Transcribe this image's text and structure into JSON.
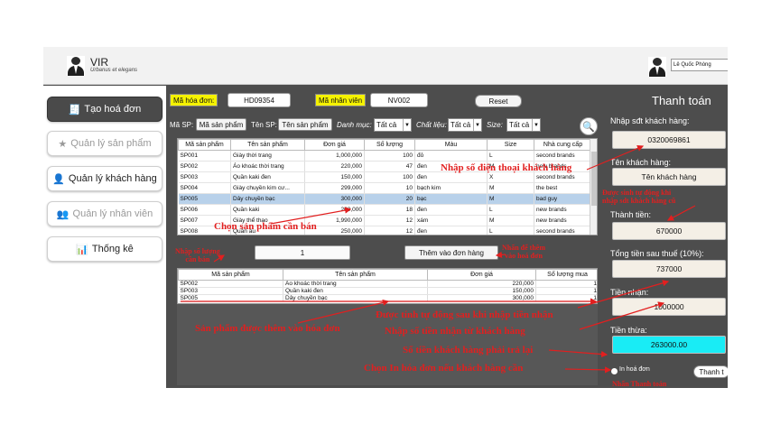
{
  "header": {
    "brand_name": "VIR",
    "brand_slogan": "Urbanus et elegans",
    "user_name": "Lê Quốc Phòng"
  },
  "sidebar": {
    "items": [
      {
        "label": "Tạo hoá đơn",
        "icon": "invoice-icon"
      },
      {
        "label": "Quản lý sản phẩm",
        "icon": "star-icon"
      },
      {
        "label": "Quản lý khách hàng",
        "icon": "customer-icon"
      },
      {
        "label": "Quản lý nhân viên",
        "icon": "staff-icon"
      },
      {
        "label": "Thống kê",
        "icon": "report-icon"
      }
    ]
  },
  "invoice": {
    "invoice_id_label": "Mã hóa đơn:",
    "invoice_id": "HD09354",
    "staff_id_label": "Mã nhân viên",
    "staff_id": "NV002",
    "reset_label": "Reset"
  },
  "filters": {
    "product_id_label": "Mã SP:",
    "product_id_button": "Mã sản phẩm",
    "product_name_label": "Tên SP:",
    "product_name_button": "Tên sản phẩm",
    "category_label": "Danh mục:",
    "category_value": "Tất cả",
    "material_label": "Chất liệu:",
    "material_value": "Tất cả",
    "size_label": "Size:",
    "size_value": "Tất cả"
  },
  "products": {
    "columns": [
      "Mã sản phẩm",
      "Tên sản phẩm",
      "Đơn giá",
      "Số lượng",
      "Màu",
      "Size",
      "Nhà cung cấp"
    ],
    "rows": [
      [
        "SP001",
        "Giày thời trang",
        "1,000,000",
        "100",
        "đỏ",
        "L",
        "second brands"
      ],
      [
        "SP002",
        "Áo khoác thời trang",
        "220,000",
        "47",
        "đen",
        "M",
        "new brands"
      ],
      [
        "SP003",
        "Quần kaki đen",
        "150,000",
        "100",
        "đen",
        "X",
        "second brands"
      ],
      [
        "SP004",
        "Giày chuyền kim cư...",
        "299,000",
        "10",
        "bạch kim",
        "M",
        "the best"
      ],
      [
        "SP005",
        "Dây chuyền bạc",
        "300,000",
        "20",
        "bạc",
        "M",
        "bad guy"
      ],
      [
        "SP006",
        "Quần kaki",
        "200,000",
        "18",
        "đen",
        "L",
        "new brands"
      ],
      [
        "SP007",
        "Giày thể thao",
        "1,990,000",
        "12",
        "xám",
        "M",
        "new brands"
      ],
      [
        "SP008",
        "Quần âu",
        "250,000",
        "12",
        "đen",
        "L",
        "second brands"
      ]
    ],
    "selected_index": 4
  },
  "quantity": {
    "value": "1",
    "add_button": "Thêm vào đơn hàng"
  },
  "cart": {
    "columns": [
      "Mã sản phẩm",
      "Tên sản phẩm",
      "Đơn giá",
      "Số lượng mua"
    ],
    "rows": [
      [
        "SP002",
        "Áo khoác thời trang",
        "220,000",
        "1"
      ],
      [
        "SP003",
        "Quần kaki đen",
        "150,000",
        "1"
      ],
      [
        "SP005",
        "Dây chuyền bạc",
        "300,000",
        "1"
      ]
    ]
  },
  "payment": {
    "title": "Thanh toán",
    "phone_label": "Nhập sđt khách hàng:",
    "phone": "0320069861",
    "customer_label": "Tên khách hàng:",
    "customer": "Tên khách hàng",
    "subtotal_label": "Thành tiền:",
    "subtotal": "670000",
    "total_label": "Tổng tiền sau thuế (10%):",
    "total": "737000",
    "received_label": "Tiền nhận:",
    "received": "1000000",
    "change_label": "Tiền thừa:",
    "change": "263000.00",
    "print_label": "In hoá đơn",
    "pay_button": "Thanh t"
  },
  "annotations": {
    "phone": "Nhập số điện thoại khách hàng",
    "auto_name": "Được sinh tự động khi\nnhập sdt khách hàng cũ",
    "choose_product": "Chọn sản phẩm cần bán",
    "enter_quantity": "Nhập số lượng\ncần bán",
    "press_add": "Nhấn để thêm\nvào hoá đơn",
    "added": "Sản phẩm được thêm vào hóa đơn",
    "auto_change": "Được tính tự động sau khi nhập tiền nhận",
    "enter_received": "Nhập số tiền nhận từ khách hàng",
    "change_back": "Số tiền khách hàng phải trả lại",
    "print": "Chọn In hóa đơn nếu khách hàng cần",
    "press_pay": "Nhấn Thanh toán"
  },
  "colors": {
    "annotation": "#e21f1f",
    "label_yellow": "#f5f200",
    "change_field": "#19ecf5",
    "selected_row": "#b8d1ea"
  }
}
